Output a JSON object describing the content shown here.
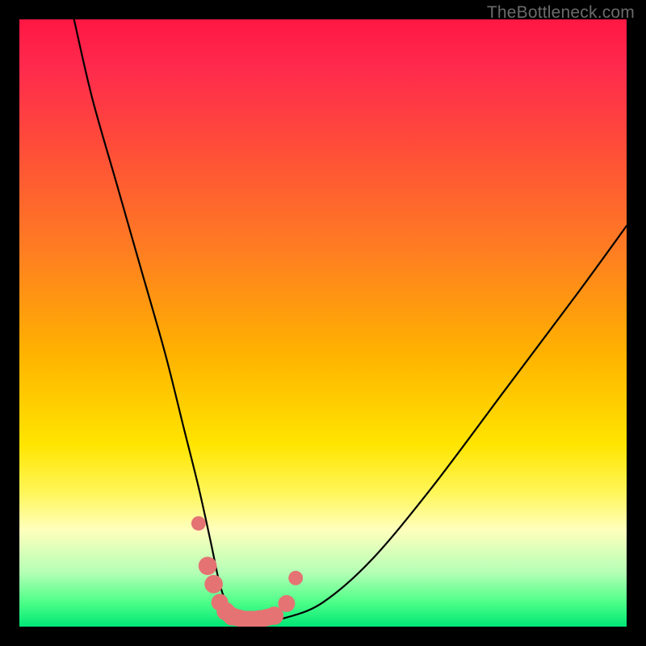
{
  "watermark": "TheBottleneck.com",
  "chart_data": {
    "type": "line",
    "title": "",
    "xlabel": "",
    "ylabel": "",
    "xlim": [
      0,
      100
    ],
    "ylim": [
      0,
      100
    ],
    "series": [
      {
        "name": "bottleneck-curve",
        "x": [
          9,
          12,
          16,
          20,
          24,
          27,
          29.5,
          31.5,
          33,
          34.5,
          36,
          40,
          44,
          50,
          58,
          68,
          80,
          92,
          100
        ],
        "values": [
          100,
          87,
          73,
          59,
          45,
          33,
          23,
          14,
          7,
          3,
          1.5,
          1,
          1.5,
          4,
          11,
          23,
          39,
          55,
          66
        ]
      }
    ],
    "markers": {
      "name": "highlight-segment",
      "color": "#e57373",
      "x": [
        29.5,
        31,
        32,
        33,
        34,
        35,
        37,
        39.5,
        42,
        44,
        45.5
      ],
      "values": [
        17,
        10,
        7,
        4,
        2.5,
        1.7,
        1.2,
        1.2,
        1.8,
        3.8,
        8
      ]
    }
  }
}
